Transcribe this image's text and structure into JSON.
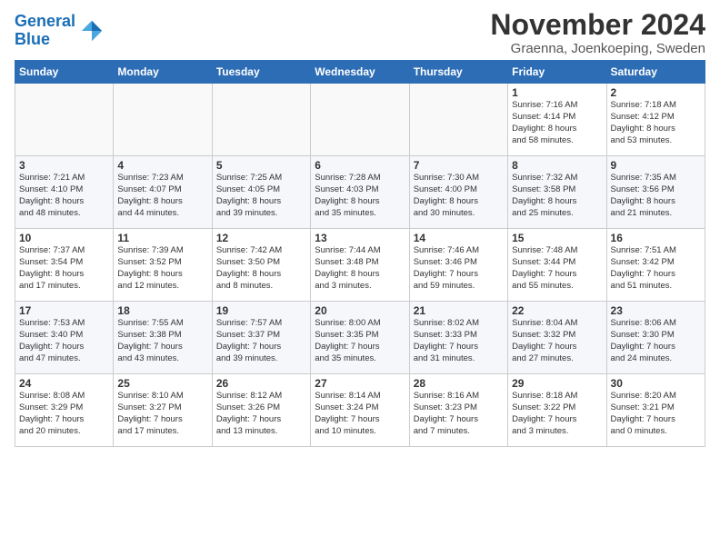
{
  "header": {
    "logo_line1": "General",
    "logo_line2": "Blue",
    "month": "November 2024",
    "location": "Graenna, Joenkoeping, Sweden"
  },
  "weekdays": [
    "Sunday",
    "Monday",
    "Tuesday",
    "Wednesday",
    "Thursday",
    "Friday",
    "Saturday"
  ],
  "weeks": [
    [
      {
        "day": "",
        "info": ""
      },
      {
        "day": "",
        "info": ""
      },
      {
        "day": "",
        "info": ""
      },
      {
        "day": "",
        "info": ""
      },
      {
        "day": "",
        "info": ""
      },
      {
        "day": "1",
        "info": "Sunrise: 7:16 AM\nSunset: 4:14 PM\nDaylight: 8 hours\nand 58 minutes."
      },
      {
        "day": "2",
        "info": "Sunrise: 7:18 AM\nSunset: 4:12 PM\nDaylight: 8 hours\nand 53 minutes."
      }
    ],
    [
      {
        "day": "3",
        "info": "Sunrise: 7:21 AM\nSunset: 4:10 PM\nDaylight: 8 hours\nand 48 minutes."
      },
      {
        "day": "4",
        "info": "Sunrise: 7:23 AM\nSunset: 4:07 PM\nDaylight: 8 hours\nand 44 minutes."
      },
      {
        "day": "5",
        "info": "Sunrise: 7:25 AM\nSunset: 4:05 PM\nDaylight: 8 hours\nand 39 minutes."
      },
      {
        "day": "6",
        "info": "Sunrise: 7:28 AM\nSunset: 4:03 PM\nDaylight: 8 hours\nand 35 minutes."
      },
      {
        "day": "7",
        "info": "Sunrise: 7:30 AM\nSunset: 4:00 PM\nDaylight: 8 hours\nand 30 minutes."
      },
      {
        "day": "8",
        "info": "Sunrise: 7:32 AM\nSunset: 3:58 PM\nDaylight: 8 hours\nand 25 minutes."
      },
      {
        "day": "9",
        "info": "Sunrise: 7:35 AM\nSunset: 3:56 PM\nDaylight: 8 hours\nand 21 minutes."
      }
    ],
    [
      {
        "day": "10",
        "info": "Sunrise: 7:37 AM\nSunset: 3:54 PM\nDaylight: 8 hours\nand 17 minutes."
      },
      {
        "day": "11",
        "info": "Sunrise: 7:39 AM\nSunset: 3:52 PM\nDaylight: 8 hours\nand 12 minutes."
      },
      {
        "day": "12",
        "info": "Sunrise: 7:42 AM\nSunset: 3:50 PM\nDaylight: 8 hours\nand 8 minutes."
      },
      {
        "day": "13",
        "info": "Sunrise: 7:44 AM\nSunset: 3:48 PM\nDaylight: 8 hours\nand 3 minutes."
      },
      {
        "day": "14",
        "info": "Sunrise: 7:46 AM\nSunset: 3:46 PM\nDaylight: 7 hours\nand 59 minutes."
      },
      {
        "day": "15",
        "info": "Sunrise: 7:48 AM\nSunset: 3:44 PM\nDaylight: 7 hours\nand 55 minutes."
      },
      {
        "day": "16",
        "info": "Sunrise: 7:51 AM\nSunset: 3:42 PM\nDaylight: 7 hours\nand 51 minutes."
      }
    ],
    [
      {
        "day": "17",
        "info": "Sunrise: 7:53 AM\nSunset: 3:40 PM\nDaylight: 7 hours\nand 47 minutes."
      },
      {
        "day": "18",
        "info": "Sunrise: 7:55 AM\nSunset: 3:38 PM\nDaylight: 7 hours\nand 43 minutes."
      },
      {
        "day": "19",
        "info": "Sunrise: 7:57 AM\nSunset: 3:37 PM\nDaylight: 7 hours\nand 39 minutes."
      },
      {
        "day": "20",
        "info": "Sunrise: 8:00 AM\nSunset: 3:35 PM\nDaylight: 7 hours\nand 35 minutes."
      },
      {
        "day": "21",
        "info": "Sunrise: 8:02 AM\nSunset: 3:33 PM\nDaylight: 7 hours\nand 31 minutes."
      },
      {
        "day": "22",
        "info": "Sunrise: 8:04 AM\nSunset: 3:32 PM\nDaylight: 7 hours\nand 27 minutes."
      },
      {
        "day": "23",
        "info": "Sunrise: 8:06 AM\nSunset: 3:30 PM\nDaylight: 7 hours\nand 24 minutes."
      }
    ],
    [
      {
        "day": "24",
        "info": "Sunrise: 8:08 AM\nSunset: 3:29 PM\nDaylight: 7 hours\nand 20 minutes."
      },
      {
        "day": "25",
        "info": "Sunrise: 8:10 AM\nSunset: 3:27 PM\nDaylight: 7 hours\nand 17 minutes."
      },
      {
        "day": "26",
        "info": "Sunrise: 8:12 AM\nSunset: 3:26 PM\nDaylight: 7 hours\nand 13 minutes."
      },
      {
        "day": "27",
        "info": "Sunrise: 8:14 AM\nSunset: 3:24 PM\nDaylight: 7 hours\nand 10 minutes."
      },
      {
        "day": "28",
        "info": "Sunrise: 8:16 AM\nSunset: 3:23 PM\nDaylight: 7 hours\nand 7 minutes."
      },
      {
        "day": "29",
        "info": "Sunrise: 8:18 AM\nSunset: 3:22 PM\nDaylight: 7 hours\nand 3 minutes."
      },
      {
        "day": "30",
        "info": "Sunrise: 8:20 AM\nSunset: 3:21 PM\nDaylight: 7 hours\nand 0 minutes."
      }
    ]
  ]
}
